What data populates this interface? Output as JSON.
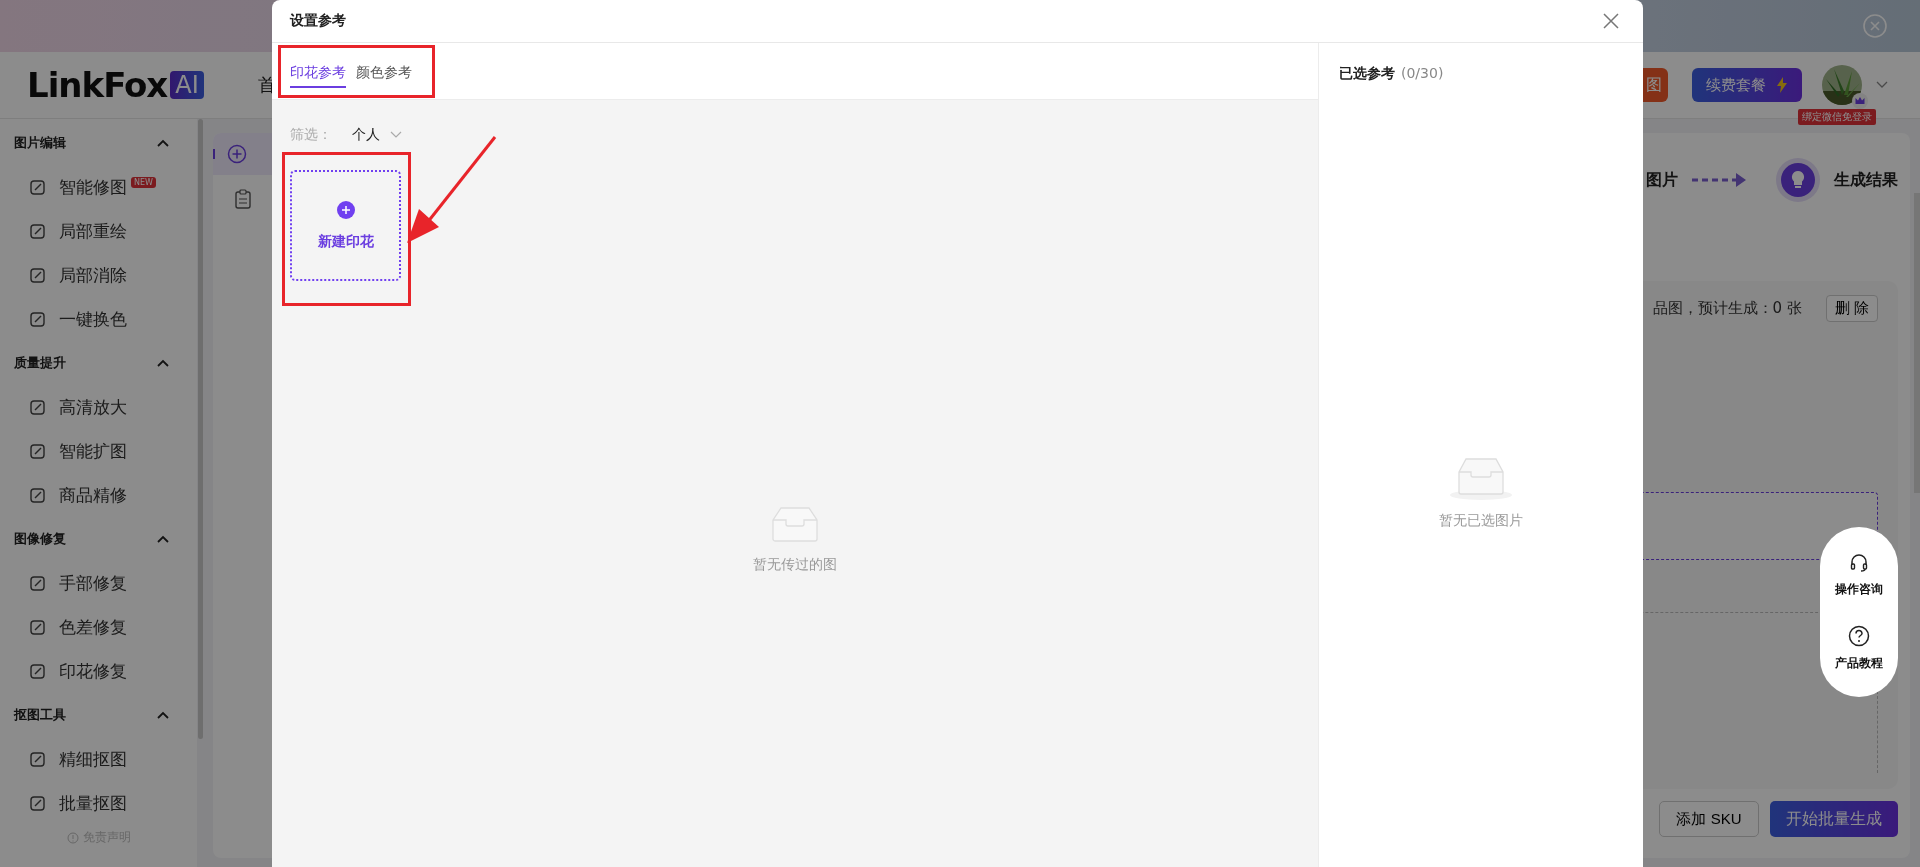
{
  "header": {
    "logo": {
      "text": "LinkFox",
      "badge": "AI"
    },
    "nav": [
      "首"
    ],
    "promo_button": "图",
    "renew_button": "续费套餐",
    "avatar_badge": "绑定微信免登录"
  },
  "sidebar": {
    "sections": [
      {
        "title": "图片编辑",
        "expanded": true,
        "items": [
          {
            "label": "智能修图",
            "badge": "NEW"
          },
          {
            "label": "局部重绘"
          },
          {
            "label": "局部消除"
          },
          {
            "label": "一键换色"
          }
        ]
      },
      {
        "title": "质量提升",
        "expanded": true,
        "items": [
          {
            "label": "高清放大"
          },
          {
            "label": "智能扩图"
          },
          {
            "label": "商品精修"
          }
        ]
      },
      {
        "title": "图像修复",
        "expanded": true,
        "items": [
          {
            "label": "手部修复"
          },
          {
            "label": "色差修复"
          },
          {
            "label": "印花修复"
          }
        ]
      },
      {
        "title": "抠图工具",
        "expanded": true,
        "items": [
          {
            "label": "精细抠图"
          },
          {
            "label": "批量抠图"
          }
        ]
      }
    ],
    "footer": "免责声明"
  },
  "main": {
    "steps": [
      {
        "label": "图片"
      },
      {
        "label": "生成结果"
      }
    ],
    "summary": "品图，预计生成：0 张",
    "delete_button": "删 除",
    "add_button": "添加 SKU",
    "start_button": "开始批量生成"
  },
  "help_float": [
    {
      "label": "操作咨询"
    },
    {
      "label": "产品教程"
    }
  ],
  "dialog": {
    "title": "设置参考",
    "tabs": [
      {
        "label": "印花参考",
        "selected": true
      },
      {
        "label": "颜色参考",
        "selected": false
      }
    ],
    "filter": {
      "label": "筛选：",
      "value": "个人"
    },
    "new_card": "新建印花",
    "empty_text": "暂无传过的图",
    "selected_panel": {
      "title": "已选参考",
      "count": "(0/30)",
      "empty_text": "暂无已选图片"
    }
  }
}
